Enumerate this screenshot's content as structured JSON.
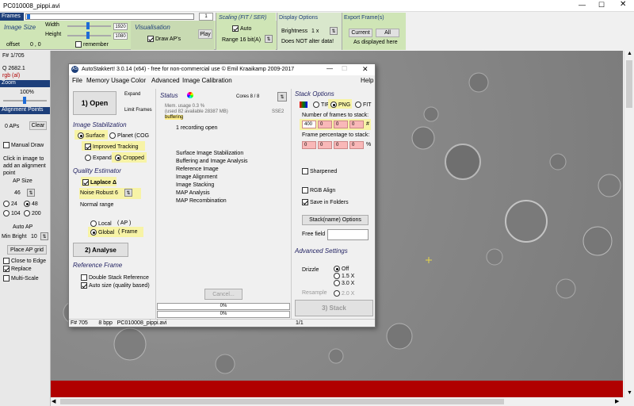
{
  "window": {
    "title": "PC010008_pippi.avi"
  },
  "frames": {
    "label": "Frames",
    "counter": "1"
  },
  "image_size": {
    "heading": "Image Size",
    "width_label": "Width",
    "height_label": "Height",
    "width": "1920",
    "height": "1080",
    "offset_label": "offset",
    "offset": "0 , 0",
    "remember": "remember"
  },
  "visualisation": {
    "heading": "Visualisation",
    "draw_aps": "Draw AP's",
    "play": "Play"
  },
  "scaling": {
    "heading": "Scaling (FIT / SER)",
    "auto": "Auto",
    "range": "Range 16 bit(A)"
  },
  "display": {
    "heading": "Display Options",
    "brightness_label": "Brightness",
    "brightness": "1 x",
    "note": "Does NOT alter data!"
  },
  "export": {
    "heading": "Export Frame(s)",
    "current": "Current",
    "all": "All",
    "note": "As displayed here"
  },
  "left": {
    "frame_no": "F# 1/705",
    "q_value": "Q 2682.1",
    "rgb": "rgb (al)",
    "zoom_label": "Zoom",
    "zoom": "100%",
    "ap_header": "Alignment Points",
    "aps_count": "0 APs",
    "clear": "Clear",
    "manual_draw": "Manual Draw",
    "click_hint": "Click in image to add an alignment point",
    "ap_size_label": "AP Size",
    "ap_size_top": "46",
    "s24": "24",
    "s48": "48",
    "s104": "104",
    "s200": "200",
    "auto_ap": "Auto AP",
    "min_bright_label": "Min Bright",
    "min_bright": "10",
    "place_grid": "Place AP grid",
    "close_edge": "Close to Edge",
    "replace": "Replace",
    "multi_scale": "Multi-Scale"
  },
  "dialog": {
    "title": "AutoStakkert! 3.0.14 (x64) - free for non-commercial use © Emil Kraaikamp 2009-2017",
    "menu": [
      "File",
      "Memory Usage",
      "Color",
      "Advanced",
      "Image Calibration",
      "Help"
    ],
    "open": "1) Open",
    "expand": "Expand",
    "limit_frames": "Limit Frames",
    "stab_heading": "Image Stabilization",
    "surface": "Surface",
    "planet": "Planet (COG",
    "improved_tracking": "Improved Tracking",
    "expand2": "Expand",
    "cropped": "Cropped",
    "quality_heading": "Quality Estimator",
    "laplace": "Laplace Δ",
    "noise_robust": "Noise Robust",
    "noise_val": "6",
    "normal_range": "Normal range",
    "local": "Local",
    "local_ap": "( AP )",
    "global": "Global",
    "global_frame": "( Frame",
    "analyse": "2) Analyse",
    "ref_heading": "Reference Frame",
    "double_stack": "Double Stack Reference",
    "auto_size": "Auto size (quality based)",
    "status_heading": "Status",
    "mem_usage": "Mem. usage 0.3 %",
    "mem_detail": "(used 82 available 28387 MB)",
    "buffering": "buffering",
    "cores": "Cores 8 / 8",
    "sse": "SSE2",
    "recording_open": "1 recording open",
    "steps": [
      "Surface Image Stabilization",
      "Buffering and Image Analysis",
      "Reference Image",
      "Image Alignment",
      "Image Stacking",
      "MAP Analysis",
      "MAP Recombination"
    ],
    "cancel": "Cancel...",
    "progress1": "0%",
    "progress2": "0%",
    "stack_heading": "Stack Options",
    "tif": "TIF",
    "png": "PNG",
    "fit": "FIT",
    "frames_to_stack_label": "Number of frames to stack:",
    "frames_to_stack": [
      "400",
      "0",
      "0",
      "0"
    ],
    "frames_unit": "#",
    "percent_label": "Frame percentage to stack:",
    "percent": [
      "0",
      "0",
      "0",
      "0"
    ],
    "percent_unit": "%",
    "sharpened": "Sharpened",
    "rgb_align": "RGB Align",
    "save_folders": "Save in Folders",
    "stackname": "Stack(name) Options",
    "free_field": "Free field",
    "adv_heading": "Advanced Settings",
    "drizzle": "Drizzle",
    "off": "Off",
    "x15": "1.5 X",
    "x30": "3.0 X",
    "resample": "Resample",
    "x20": "2.0 X",
    "stack_btn": "3) Stack",
    "status_bar": "F# 705       8 bpp   PC010008_pippi.avi",
    "status_pages": "1/1"
  },
  "colors": {
    "toolbar_green": "#cfe5b6",
    "moon_gray": "#8e8e8e",
    "red_bar": "#b00000"
  }
}
